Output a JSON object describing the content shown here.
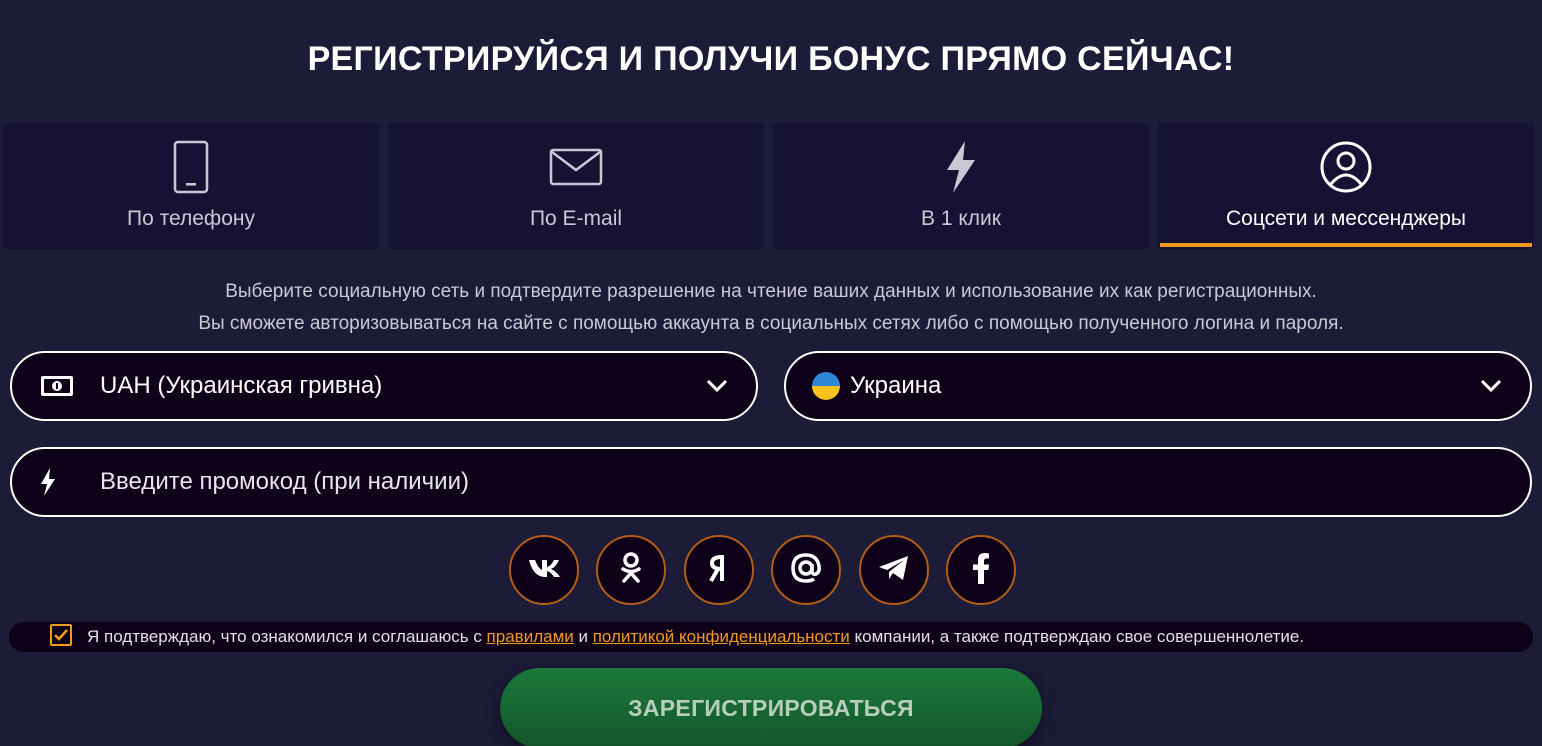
{
  "heading": "РЕГИСТРИРУЙСЯ И ПОЛУЧИ БОНУС ПРЯМО СЕЙЧАС!",
  "tabs": [
    {
      "label": "По телефону",
      "icon": "phone-icon",
      "active": false
    },
    {
      "label": "По E-mail",
      "icon": "mail-icon",
      "active": false
    },
    {
      "label": "В 1 клик",
      "icon": "lightning-icon",
      "active": false
    },
    {
      "label": "Соцсети и мессенджеры",
      "icon": "user-circle-icon",
      "active": true
    }
  ],
  "description": {
    "line1": "Выберите социальную сеть и подтвердите разрешение на чтение ваших данных и использование их как регистрационных.",
    "line2": "Вы сможете авторизовываться на сайте с помощью аккаунта в социальных сетях либо с помощью полученного логина и пароля."
  },
  "currency": {
    "value": "UAH (Украинская гривна)",
    "icon": "banknote-icon"
  },
  "country": {
    "value": "Украина",
    "icon": "ukraine-flag-icon"
  },
  "promo": {
    "placeholder": "Введите промокод (при наличии)",
    "value": "",
    "icon": "lightning-icon"
  },
  "socials": [
    {
      "name": "vk",
      "icon": "vk-icon"
    },
    {
      "name": "odnoklassniki",
      "icon": "ok-icon"
    },
    {
      "name": "yandex",
      "icon": "yandex-icon"
    },
    {
      "name": "mail",
      "icon": "at-icon"
    },
    {
      "name": "telegram",
      "icon": "telegram-icon"
    },
    {
      "name": "facebook",
      "icon": "facebook-icon"
    }
  ],
  "agreement": {
    "checked": true,
    "text_before": "Я подтверждаю, что ознакомился и соглашаюсь с ",
    "link_rules": "правилами",
    "text_and": " и ",
    "link_privacy": "политикой конфиденциальности",
    "text_after": " компании, а также подтверждаю свое совершеннолетие."
  },
  "register_button": "ЗАРЕГИСТРИРОВАТЬСЯ",
  "colors": {
    "background": "#1c1b38",
    "tab_bg": "#151233",
    "accent": "#f39a1e",
    "field_bg": "#0d0018",
    "button_green": "#1b7a3a"
  }
}
